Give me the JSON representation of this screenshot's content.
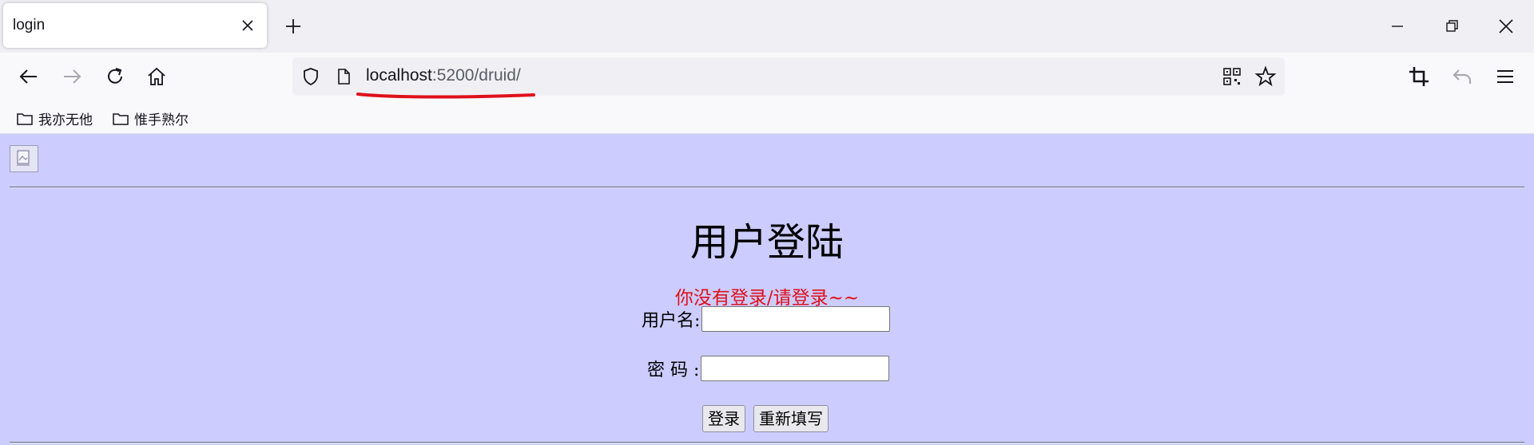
{
  "browser": {
    "tab": {
      "title": "login"
    },
    "url": {
      "host": "localhost",
      "rest": ":5200/druid/"
    },
    "bookmarks": [
      {
        "label": "我亦无他"
      },
      {
        "label": "惟手熟尔"
      }
    ],
    "annotation_color": "#e0101a"
  },
  "page": {
    "title": "用户登陆",
    "message": "你没有登录/请登录~~",
    "form": {
      "username_label": "用户名:",
      "username_value": "",
      "password_label": "密 码 :",
      "password_value": "",
      "login_button": "登录",
      "reset_button": "重新填写"
    },
    "background": "#ccccff"
  }
}
